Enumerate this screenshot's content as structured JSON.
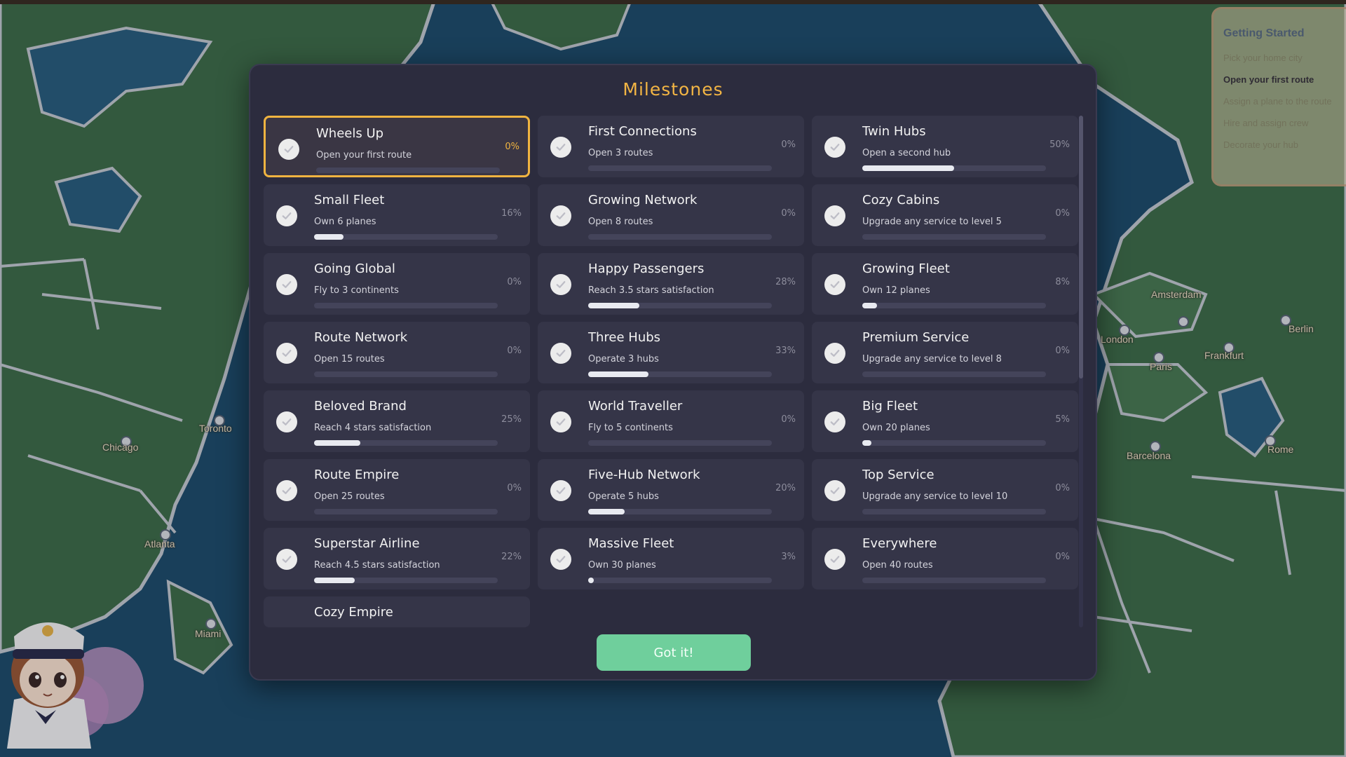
{
  "colors": {
    "ocean": "#1f4e6e",
    "land": "#3f6d4c",
    "border": "#b9c1cc",
    "accent": "#f2b544",
    "button": "#6fcf9c",
    "modal_bg": "#2c2c3e",
    "card_bg": "#353548"
  },
  "map": {
    "cities": [
      "Chicago",
      "Toronto",
      "Atlanta",
      "Miami",
      "Amsterdam",
      "London",
      "Paris",
      "Frankfurt",
      "Berlin",
      "Barcelona",
      "Rome"
    ]
  },
  "getting_started": {
    "title": "Getting Started",
    "steps": [
      {
        "label": "Pick your home city",
        "state": "done"
      },
      {
        "label": "Open your first route",
        "state": "active"
      },
      {
        "label": "Assign a plane to the route",
        "state": "pending"
      },
      {
        "label": "Hire and assign crew",
        "state": "pending"
      },
      {
        "label": "Decorate your hub",
        "state": "pending"
      }
    ]
  },
  "modal": {
    "title": "Milestones",
    "button_label": "Got it!",
    "milestones": [
      {
        "name": "Wheels Up",
        "desc": "Open your first route",
        "pct": "0%",
        "progress": 0,
        "highlight": true
      },
      {
        "name": "First Connections",
        "desc": "Open 3 routes",
        "pct": "0%",
        "progress": 0
      },
      {
        "name": "Twin Hubs",
        "desc": "Open a second hub",
        "pct": "50%",
        "progress": 50
      },
      {
        "name": "Small Fleet",
        "desc": "Own 6 planes",
        "pct": "16%",
        "progress": 16
      },
      {
        "name": "Growing Network",
        "desc": "Open 8 routes",
        "pct": "0%",
        "progress": 0
      },
      {
        "name": "Cozy Cabins",
        "desc": "Upgrade any service to level 5",
        "pct": "0%",
        "progress": 0
      },
      {
        "name": "Going Global",
        "desc": "Fly to 3 continents",
        "pct": "0%",
        "progress": 0
      },
      {
        "name": "Happy Passengers",
        "desc": "Reach 3.5 stars satisfaction",
        "pct": "28%",
        "progress": 28
      },
      {
        "name": "Growing Fleet",
        "desc": "Own 12 planes",
        "pct": "8%",
        "progress": 8
      },
      {
        "name": "Route Network",
        "desc": "Open 15 routes",
        "pct": "0%",
        "progress": 0
      },
      {
        "name": "Three Hubs",
        "desc": "Operate 3 hubs",
        "pct": "33%",
        "progress": 33
      },
      {
        "name": "Premium Service",
        "desc": "Upgrade any service to level 8",
        "pct": "0%",
        "progress": 0
      },
      {
        "name": "Beloved Brand",
        "desc": "Reach 4 stars satisfaction",
        "pct": "25%",
        "progress": 25
      },
      {
        "name": "World Traveller",
        "desc": "Fly to 5 continents",
        "pct": "0%",
        "progress": 0
      },
      {
        "name": "Big Fleet",
        "desc": "Own 20 planes",
        "pct": "5%",
        "progress": 5
      },
      {
        "name": "Route Empire",
        "desc": "Open 25 routes",
        "pct": "0%",
        "progress": 0
      },
      {
        "name": "Five-Hub Network",
        "desc": "Operate 5 hubs",
        "pct": "20%",
        "progress": 20
      },
      {
        "name": "Top Service",
        "desc": "Upgrade any service to level 10",
        "pct": "0%",
        "progress": 0
      },
      {
        "name": "Superstar Airline",
        "desc": "Reach 4.5 stars satisfaction",
        "pct": "22%",
        "progress": 22
      },
      {
        "name": "Massive Fleet",
        "desc": "Own 30 planes",
        "pct": "3%",
        "progress": 3
      },
      {
        "name": "Everywhere",
        "desc": "Open 40 routes",
        "pct": "0%",
        "progress": 0
      },
      {
        "name": "Cozy Empire",
        "partial": true
      }
    ]
  }
}
